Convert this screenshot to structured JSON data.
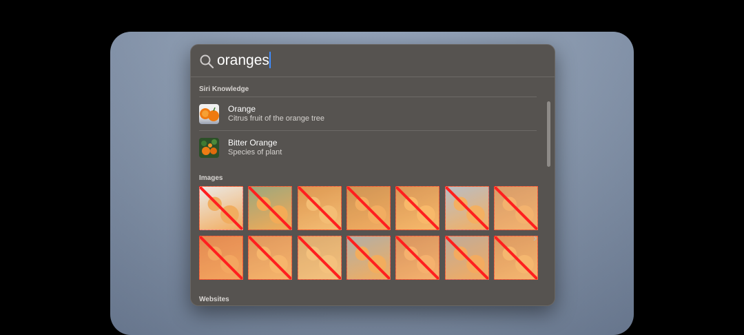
{
  "search": {
    "query": "oranges"
  },
  "sections": {
    "siri_knowledge": "Siri Knowledge",
    "images": "Images",
    "websites": "Websites"
  },
  "results": [
    {
      "title": "Orange",
      "subtitle": "Citrus fruit of the orange tree"
    },
    {
      "title": "Bitter Orange",
      "subtitle": "Species of plant"
    }
  ],
  "image_tiles": [
    {
      "status": "redacted"
    },
    {
      "status": "redacted"
    },
    {
      "status": "redacted"
    },
    {
      "status": "redacted"
    },
    {
      "status": "redacted"
    },
    {
      "status": "redacted"
    },
    {
      "status": "redacted"
    },
    {
      "status": "redacted"
    },
    {
      "status": "redacted"
    },
    {
      "status": "redacted"
    },
    {
      "status": "redacted"
    },
    {
      "status": "redacted"
    },
    {
      "status": "redacted"
    },
    {
      "status": "redacted"
    }
  ],
  "colors": {
    "panel": "#565350",
    "caret": "#3f8cff",
    "redaction": "#ff0000"
  },
  "icons": {
    "search": "magnifying-glass",
    "next": "chevron-right"
  }
}
